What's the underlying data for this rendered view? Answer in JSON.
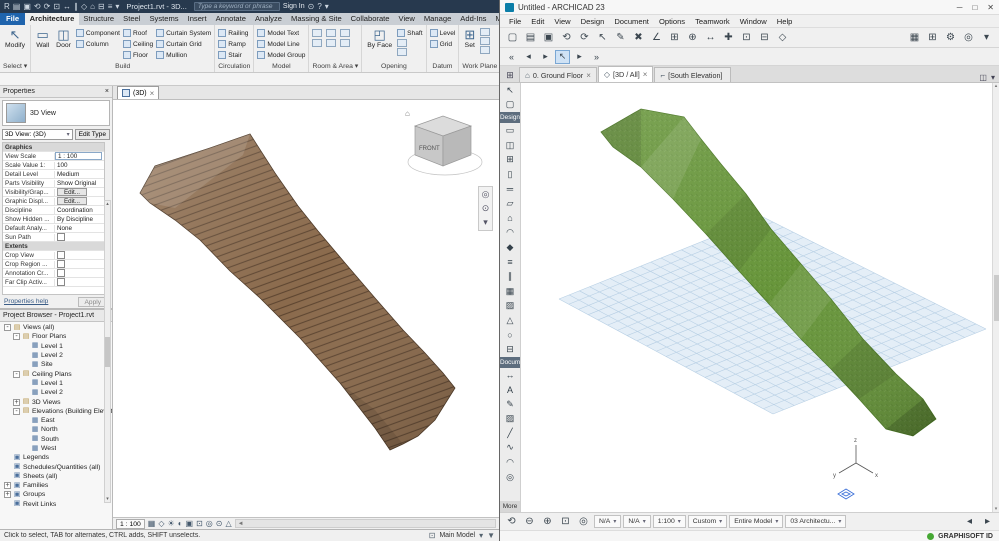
{
  "colors": {
    "revit-title": "#27394e",
    "file-blue": "#1f64ad",
    "terrain-brown": "#8a6a4c",
    "contour-brown": "#5d4530",
    "terrain-green": "#67953a",
    "grid-blue": "#b7cfe4",
    "plane-blue": "#e4eef7",
    "gs-green": "#46a834"
  },
  "icons": {
    "close": "×",
    "caret": "▾",
    "up": "▴",
    "down": "▾",
    "left": "◂",
    "right": "▸",
    "scroll_left": "◄",
    "nav_wheel": "◎",
    "nav_zoom": "⊙",
    "workset": "⊡",
    "filter": "▼",
    "help": "?"
  },
  "revit": {
    "title": "Project1.rvt - 3D...",
    "search_placeholder": "Type a keyword or phrase",
    "sign_in": "Sign In",
    "qat": [
      {
        "n": "app-menu-button",
        "g": "R"
      },
      {
        "n": "open-icon",
        "g": "▤"
      },
      {
        "n": "save-icon",
        "g": "▣"
      },
      {
        "n": "undo-icon",
        "g": "⟲"
      },
      {
        "n": "redo-icon",
        "g": "⟳"
      },
      {
        "n": "print-icon",
        "g": "⊡"
      },
      {
        "n": "measure-icon",
        "g": "↔"
      },
      {
        "n": "aligned-dimension-icon",
        "g": "∥"
      },
      {
        "n": "tag-icon",
        "g": "◇"
      },
      {
        "n": "default-3d-view-icon",
        "g": "⌂"
      },
      {
        "n": "section-icon",
        "g": "⊟"
      },
      {
        "n": "thin-lines-icon",
        "g": "≡"
      },
      {
        "n": "qat-customize-icon",
        "g": "▾"
      }
    ],
    "title_icons": [
      {
        "n": "communication-icon",
        "g": "⊙"
      },
      {
        "n": "help-icon",
        "g": "?"
      },
      {
        "n": "help-caret-icon",
        "g": "▾"
      }
    ],
    "tabs": [
      {
        "label": "File",
        "kind": "file"
      },
      {
        "label": "Architecture",
        "active": true
      },
      {
        "label": "Structure"
      },
      {
        "label": "Steel"
      },
      {
        "label": "Systems"
      },
      {
        "label": "Insert"
      },
      {
        "label": "Annotate"
      },
      {
        "label": "Analyze"
      },
      {
        "label": "Massing & Site"
      },
      {
        "label": "Collaborate"
      },
      {
        "label": "View"
      },
      {
        "label": "Manage"
      },
      {
        "label": "Add-Ins"
      },
      {
        "label": "Modify"
      }
    ],
    "ribbon": {
      "panels": [
        "Select ▾",
        "Build",
        "Circulation",
        "Model",
        "Room & Area ▾",
        "Opening",
        "Datum",
        "Work Plane"
      ],
      "modify": "Modify",
      "wall": "Wall",
      "door": "Door",
      "component": "Component",
      "column": "Column",
      "roof": "Roof",
      "ceiling": "Ceiling",
      "floor": "Floor",
      "curtain_system": "Curtain System",
      "curtain_grid": "Curtain Grid",
      "mullion": "Mullion",
      "railing": "Railing",
      "ramp": "Ramp",
      "stair": "Stair",
      "model_text": "Model Text",
      "model_line": "Model Line",
      "model_group": "Model Group",
      "by_face": "By Face",
      "shaft": "Shaft",
      "level": "Level",
      "grid": "Grid",
      "set": "Set",
      "modify_icon": "↖",
      "wall_icon": "▭",
      "door_icon": "◫",
      "by_face_icon": "◰",
      "set_icon": "⊞"
    },
    "properties": {
      "header": "Properties",
      "type_label": "3D View",
      "combo": "3D View: (3D)",
      "edit_type": "Edit Type",
      "rows": [
        {
          "label": "Graphics",
          "kind": "group"
        },
        {
          "label": "View Scale",
          "value": "1 : 100",
          "kind": "input"
        },
        {
          "label": "Scale Value  1:",
          "value": "100"
        },
        {
          "label": "Detail Level",
          "value": "Medium"
        },
        {
          "label": "Parts Visibility",
          "value": "Show Original"
        },
        {
          "label": "Visibility/Grap...",
          "value": "Edit...",
          "kind": "btn"
        },
        {
          "label": "Graphic Displ...",
          "value": "Edit...",
          "kind": "btn"
        },
        {
          "label": "Discipline",
          "value": "Coordination"
        },
        {
          "label": "Show Hidden ...",
          "value": "By Discipline"
        },
        {
          "label": "Default Analy...",
          "value": "None"
        },
        {
          "label": "Sun Path",
          "kind": "check"
        },
        {
          "label": "Extents",
          "kind": "group"
        },
        {
          "label": "Crop View",
          "kind": "check"
        },
        {
          "label": "Crop Region ...",
          "kind": "check"
        },
        {
          "label": "Annotation Cr...",
          "kind": "check"
        },
        {
          "label": "Far Clip Activ...",
          "kind": "check"
        }
      ],
      "help": "Properties help",
      "apply": "Apply"
    },
    "browser": {
      "header": "Project Browser - Project1.rvt",
      "items": [
        {
          "label": "Views (all)",
          "depth": 0,
          "exp": "-",
          "kind": "folder"
        },
        {
          "label": "Floor Plans",
          "depth": 1,
          "exp": "-",
          "kind": "folder"
        },
        {
          "label": "Level 1",
          "depth": 2,
          "kind": "view"
        },
        {
          "label": "Level 2",
          "depth": 2,
          "kind": "view"
        },
        {
          "label": "Site",
          "depth": 2,
          "kind": "view"
        },
        {
          "label": "Ceiling Plans",
          "depth": 1,
          "exp": "-",
          "kind": "folder"
        },
        {
          "label": "Level 1",
          "depth": 2,
          "kind": "view"
        },
        {
          "label": "Level 2",
          "depth": 2,
          "kind": "view"
        },
        {
          "label": "3D Views",
          "depth": 1,
          "exp": "+",
          "kind": "folder"
        },
        {
          "label": "Elevations (Building Elevation)",
          "depth": 1,
          "exp": "-",
          "kind": "folder"
        },
        {
          "label": "East",
          "depth": 2,
          "kind": "view"
        },
        {
          "label": "North",
          "depth": 2,
          "kind": "view"
        },
        {
          "label": "South",
          "depth": 2,
          "kind": "view"
        },
        {
          "label": "West",
          "depth": 2,
          "kind": "view"
        },
        {
          "label": "Legends",
          "depth": 0,
          "kind": "cat"
        },
        {
          "label": "Schedules/Quantities (all)",
          "depth": 0,
          "kind": "cat"
        },
        {
          "label": "Sheets (all)",
          "depth": 0,
          "kind": "cat"
        },
        {
          "label": "Families",
          "depth": 0,
          "exp": "+",
          "kind": "cat"
        },
        {
          "label": "Groups",
          "depth": 0,
          "exp": "+",
          "kind": "cat"
        },
        {
          "label": "Revit Links",
          "depth": 0,
          "kind": "cat"
        }
      ]
    },
    "viewport": {
      "tab": "(3D)",
      "scale": "1 : 100",
      "viewcube_front": "FRONT"
    },
    "viewbar_icons": [
      {
        "n": "detail-level-icon",
        "g": "▦"
      },
      {
        "n": "visual-style-icon",
        "g": "◇"
      },
      {
        "n": "sun-path-icon",
        "g": "☀"
      },
      {
        "n": "shadows-icon",
        "g": "◐"
      },
      {
        "n": "crop-view-icon",
        "g": "▣"
      },
      {
        "n": "crop-region-icon",
        "g": "⊡"
      },
      {
        "n": "temporary-hide-icon",
        "g": "◎"
      },
      {
        "n": "reveal-hidden-icon",
        "g": "⊙"
      },
      {
        "n": "analytical-model-icon",
        "g": "△"
      }
    ],
    "status": {
      "hint": "Click to select, TAB for alternates, CTRL adds, SHIFT unselects.",
      "main_model": "Main Model"
    }
  },
  "archicad": {
    "title": "Untitled - ARCHICAD 23",
    "window_controls": [
      {
        "n": "minimize-icon",
        "g": "─"
      },
      {
        "n": "maximize-icon",
        "g": "□"
      },
      {
        "n": "close-icon",
        "g": "✕"
      }
    ],
    "menus": [
      "File",
      "Edit",
      "View",
      "Design",
      "Document",
      "Options",
      "Teamwork",
      "Window",
      "Help"
    ],
    "toolbar1": [
      {
        "n": "new-file-icon",
        "g": "▢"
      },
      {
        "n": "open-file-icon",
        "g": "▤"
      },
      {
        "n": "save-file-icon",
        "g": "▣"
      },
      {
        "n": "undo-icon",
        "g": "⟲"
      },
      {
        "n": "redo-icon",
        "g": "⟳"
      },
      {
        "n": "pointer-icon",
        "g": "↖"
      },
      {
        "n": "pen-icon",
        "g": "✎"
      },
      {
        "n": "delete-icon",
        "g": "✖"
      },
      {
        "n": "snap-guides-icon",
        "g": "∠"
      },
      {
        "n": "snap-grid-icon",
        "g": "⊞"
      },
      {
        "n": "gravity-icon",
        "g": "⊕"
      },
      {
        "n": "measure-icon",
        "g": "↔"
      },
      {
        "n": "magic-wand-icon",
        "g": "✚"
      },
      {
        "n": "group-icon",
        "g": "⊡"
      },
      {
        "n": "ungroup-icon",
        "g": "⊟"
      },
      {
        "n": "3d-view-icon",
        "g": "◇"
      }
    ],
    "toolbar1_right": [
      {
        "n": "layers-icon",
        "g": "▦"
      },
      {
        "n": "grid-options-icon",
        "g": "⊞"
      },
      {
        "n": "settings-icon",
        "g": "⚙"
      },
      {
        "n": "teamwork-icon",
        "g": "◎"
      },
      {
        "n": "toolbar-caret-icon",
        "g": "▾"
      }
    ],
    "toolbar2": [
      {
        "n": "go-first-icon",
        "g": "«"
      },
      {
        "n": "go-prev-icon",
        "g": "◂"
      },
      {
        "n": "go-next-icon",
        "g": "▸"
      },
      {
        "n": "arrow-tool-button",
        "g": "↖",
        "active": true
      },
      {
        "n": "arrow-sub-caret",
        "g": "▸"
      },
      {
        "n": "toolbar2-more-icon",
        "g": "»"
      }
    ],
    "tab_nav_icon": "⊞",
    "tabs": [
      {
        "g": "⌂",
        "label": "0. Ground Floor",
        "close": "×"
      },
      {
        "g": "◇",
        "label": "[3D / All]",
        "active": true,
        "close": "×"
      },
      {
        "g": "⌐",
        "label": "[South Elevation]"
      }
    ],
    "tabbar_right": [
      {
        "n": "tab-overview-icon",
        "g": "◫"
      },
      {
        "n": "tab-list-caret-icon",
        "g": "▾"
      }
    ],
    "toolbox": {
      "top_tools": [
        {
          "n": "arrow-tool",
          "g": "↖"
        },
        {
          "n": "marquee-tool",
          "g": "▢"
        }
      ],
      "design_label": "Design",
      "design_tools": [
        {
          "n": "wall-tool",
          "g": "▭"
        },
        {
          "n": "door-tool",
          "g": "◫"
        },
        {
          "n": "window-tool",
          "g": "⊞"
        },
        {
          "n": "column-tool",
          "g": "▯"
        },
        {
          "n": "beam-tool",
          "g": "═"
        },
        {
          "n": "slab-tool",
          "g": "▱"
        },
        {
          "n": "roof-tool",
          "g": "⌂"
        },
        {
          "n": "shell-tool",
          "g": "◠"
        },
        {
          "n": "morph-tool",
          "g": "◆"
        },
        {
          "n": "stair-tool",
          "g": "≡"
        },
        {
          "n": "railing-tool",
          "g": "∥"
        },
        {
          "n": "curtain-wall-tool",
          "g": "▦"
        },
        {
          "n": "zone-tool",
          "g": "▨"
        },
        {
          "n": "mesh-tool",
          "g": "△"
        },
        {
          "n": "object-tool",
          "g": "○"
        },
        {
          "n": "opening-tool",
          "g": "⊟"
        }
      ],
      "document_label": "Docume",
      "document_tools": [
        {
          "n": "dimension-tool",
          "g": "↔"
        },
        {
          "n": "text-tool",
          "g": "A"
        },
        {
          "n": "label-tool",
          "g": "✎"
        },
        {
          "n": "fill-tool",
          "g": "▨"
        },
        {
          "n": "line-tool",
          "g": "╱"
        },
        {
          "n": "polyline-tool",
          "g": "∿"
        },
        {
          "n": "arc-tool",
          "g": "◠"
        },
        {
          "n": "camera-tool",
          "g": "◎"
        }
      ],
      "more_label": "More"
    },
    "bottom": {
      "icons_left": [
        {
          "n": "zoom-undo-icon",
          "g": "⟲"
        },
        {
          "n": "zoom-out-icon",
          "g": "⊖"
        },
        {
          "n": "zoom-in-icon",
          "g": "⊕"
        },
        {
          "n": "fit-in-window-icon",
          "g": "⊡"
        },
        {
          "n": "orbit-icon",
          "g": "◎"
        }
      ],
      "fields": [
        {
          "n": "zoom-field",
          "v": "N/A"
        },
        {
          "n": "angle-field",
          "v": "N/A"
        },
        {
          "n": "scale-field",
          "v": "1:100"
        },
        {
          "n": "pen-set-field",
          "v": "Custom"
        },
        {
          "n": "model-filter-field",
          "v": "Entire Model"
        },
        {
          "n": "layer-combination-field",
          "v": "03 Architectu..."
        }
      ],
      "icons_right": [
        {
          "n": "scroll-left-icon",
          "g": "◂"
        },
        {
          "n": "scroll-right-icon",
          "g": "▸"
        }
      ]
    },
    "brand": "GRAPHISOFT ID"
  }
}
